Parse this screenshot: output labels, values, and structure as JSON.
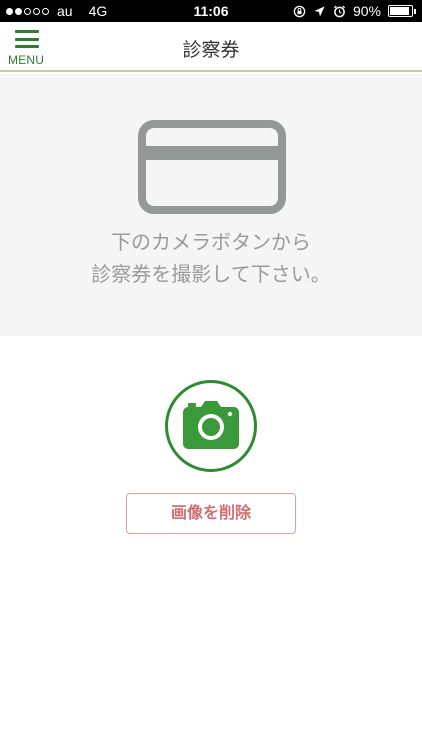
{
  "status_bar": {
    "signal_dots_filled": 2,
    "signal_dots_total": 5,
    "carrier": "au",
    "network": "4G",
    "time": "11:06",
    "icons": [
      "orientation-lock-icon",
      "location-arrow-icon",
      "alarm-icon"
    ],
    "battery_percent_label": "90%",
    "battery_level": 0.9
  },
  "nav": {
    "menu_label": "MENU",
    "title": "診察券"
  },
  "preview": {
    "icon": "card-icon",
    "instruction_line1": "下のカメラボタンから",
    "instruction_line2": "診察券を撮影して下さい。"
  },
  "actions": {
    "camera_icon": "camera-icon",
    "delete_label": "画像を削除"
  },
  "colors": {
    "accent_green": "#2e7d32",
    "divider_green": "#b7d68f",
    "delete_red": "#d07070"
  }
}
